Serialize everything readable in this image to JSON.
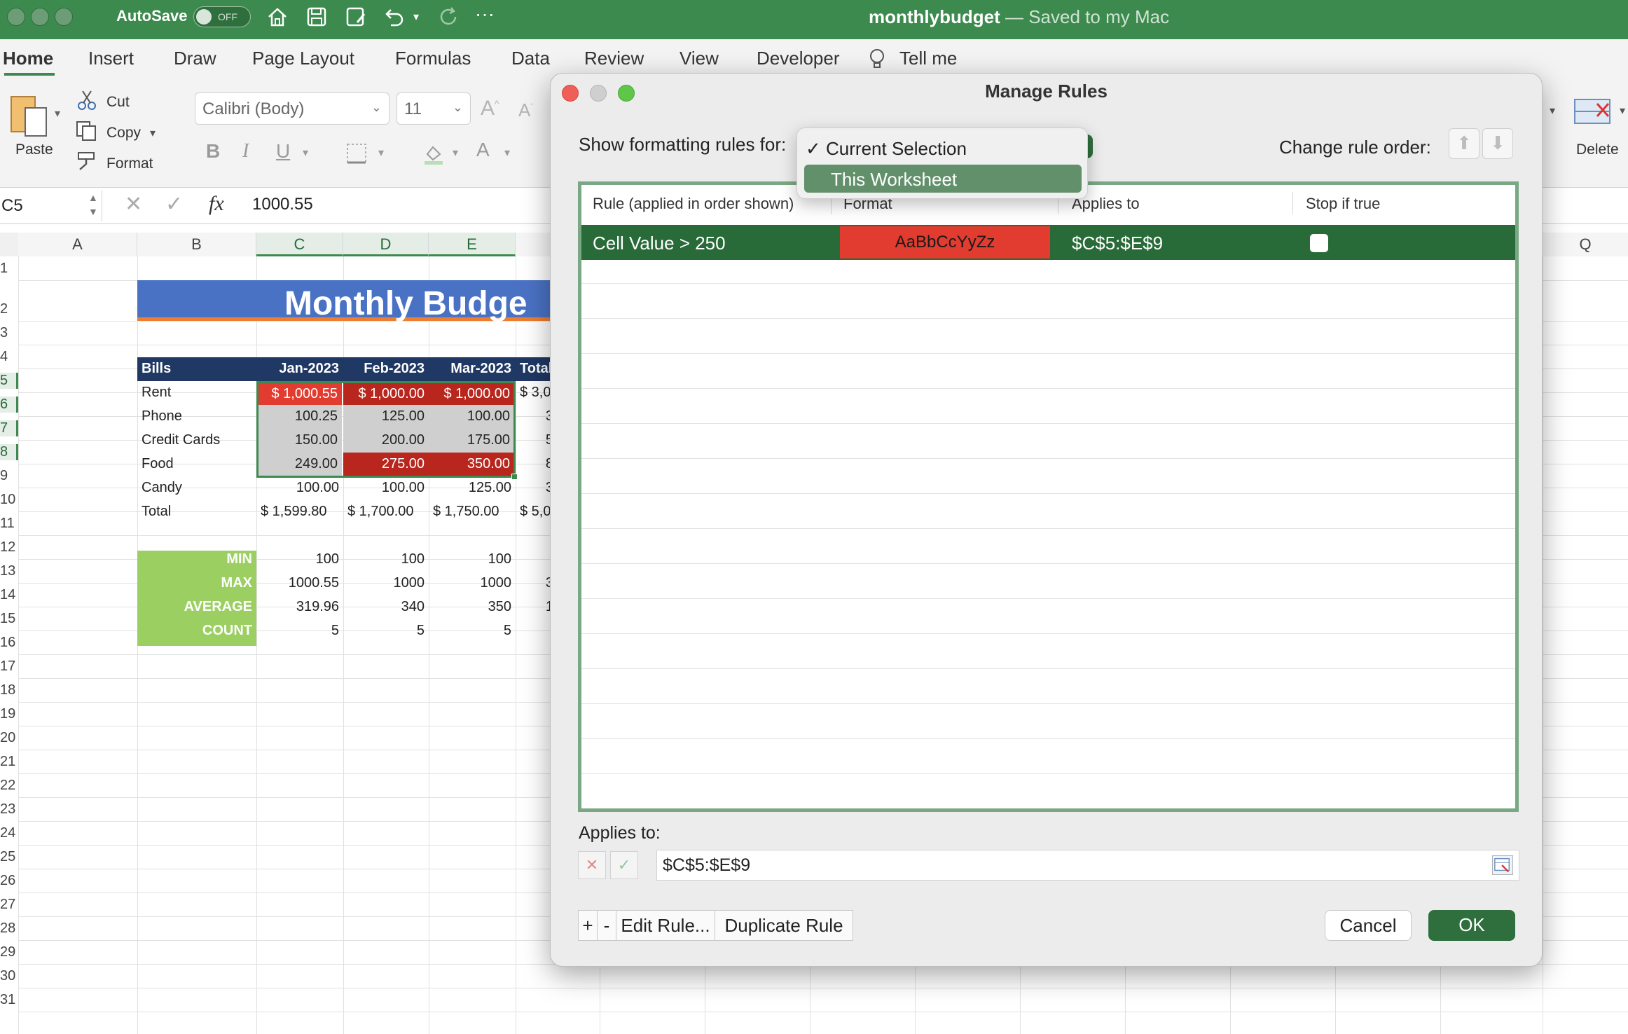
{
  "titlebar": {
    "autosave_label": "AutoSave",
    "autosave_state": "OFF",
    "doc_name": "monthlybudget",
    "doc_status": " — Saved to my Mac"
  },
  "ribbon_tabs": [
    "Home",
    "Insert",
    "Draw",
    "Page Layout",
    "Formulas",
    "Data",
    "Review",
    "View",
    "Developer",
    "Tell me"
  ],
  "ribbon": {
    "paste": "Paste",
    "cut": "Cut",
    "copy": "Copy",
    "format": "Format",
    "font_name": "Calibri (Body)",
    "font_size": "11",
    "delete": "Delete"
  },
  "formula_bar": {
    "name_box": "C5",
    "fx": "fx",
    "value": "1000.55"
  },
  "sheet": {
    "columns": [
      "A",
      "B",
      "C",
      "D",
      "E",
      "Q"
    ],
    "rows": [
      "1",
      "2",
      "3",
      "4",
      "5",
      "6",
      "7",
      "8",
      "9",
      "10",
      "11",
      "12",
      "13",
      "14",
      "15",
      "16",
      "17",
      "18",
      "19",
      "20",
      "21",
      "22",
      "23",
      "24",
      "25",
      "26",
      "27",
      "28",
      "29",
      "30",
      "31"
    ],
    "title": "Monthly Budge",
    "header": [
      "Bills",
      "Jan-2023",
      "Feb-2023",
      "Mar-2023",
      "Total"
    ],
    "bills": [
      {
        "name": "Rent",
        "jan": "$ 1,000.55",
        "feb": "$ 1,000.00",
        "mar": "$ 1,000.00",
        "total": "$ 3,0"
      },
      {
        "name": "Phone",
        "jan": "100.25",
        "feb": "125.00",
        "mar": "100.00",
        "total": "3"
      },
      {
        "name": "Credit Cards",
        "jan": "150.00",
        "feb": "200.00",
        "mar": "175.00",
        "total": "5"
      },
      {
        "name": "Food",
        "jan": "249.00",
        "feb": "275.00",
        "mar": "350.00",
        "total": "8"
      },
      {
        "name": "Candy",
        "jan": "100.00",
        "feb": "100.00",
        "mar": "125.00",
        "total": "3"
      },
      {
        "name": "Total",
        "jan": "$ 1,599.80",
        "feb": "$ 1,700.00",
        "mar": "$ 1,750.00",
        "total": "$ 5,0"
      }
    ],
    "stats": [
      {
        "label": "MIN",
        "jan": "100",
        "feb": "100",
        "mar": "100",
        "total": ""
      },
      {
        "label": "MAX",
        "jan": "1000.55",
        "feb": "1000",
        "mar": "1000",
        "total": "3"
      },
      {
        "label": "AVERAGE",
        "jan": "319.96",
        "feb": "340",
        "mar": "350",
        "total": "1"
      },
      {
        "label": "COUNT",
        "jan": "5",
        "feb": "5",
        "mar": "5",
        "total": ""
      }
    ]
  },
  "dialog": {
    "title": "Manage Rules",
    "show_rules_label": "Show formatting rules for:",
    "change_order_label": "Change rule order:",
    "columns": [
      "Rule (applied in order shown)",
      "Format",
      "Applies to",
      "Stop if true"
    ],
    "rule": {
      "condition": "Cell Value > 250",
      "format_preview": "AaBbCcYyZz",
      "applies_to": "$C$5:$E$9"
    },
    "applies_label": "Applies to:",
    "applies_value": "$C$5:$E$9",
    "add_label": "+",
    "remove_label": "-",
    "edit_label": "Edit Rule...",
    "duplicate_label": "Duplicate Rule",
    "cancel_label": "Cancel",
    "ok_label": "OK"
  },
  "scope_dropdown": {
    "options": [
      "Current Selection",
      "This Worksheet"
    ],
    "checked_mark": "✓",
    "highlighted": "This Worksheet"
  },
  "colors": {
    "title_bar": "#3c8a4e",
    "rule_row": "#286b38",
    "format_fill": "#e23b2f",
    "sheet_title": "#4a72c4",
    "stats_fill": "#9bcf62",
    "header_fill": "#1f3864"
  }
}
